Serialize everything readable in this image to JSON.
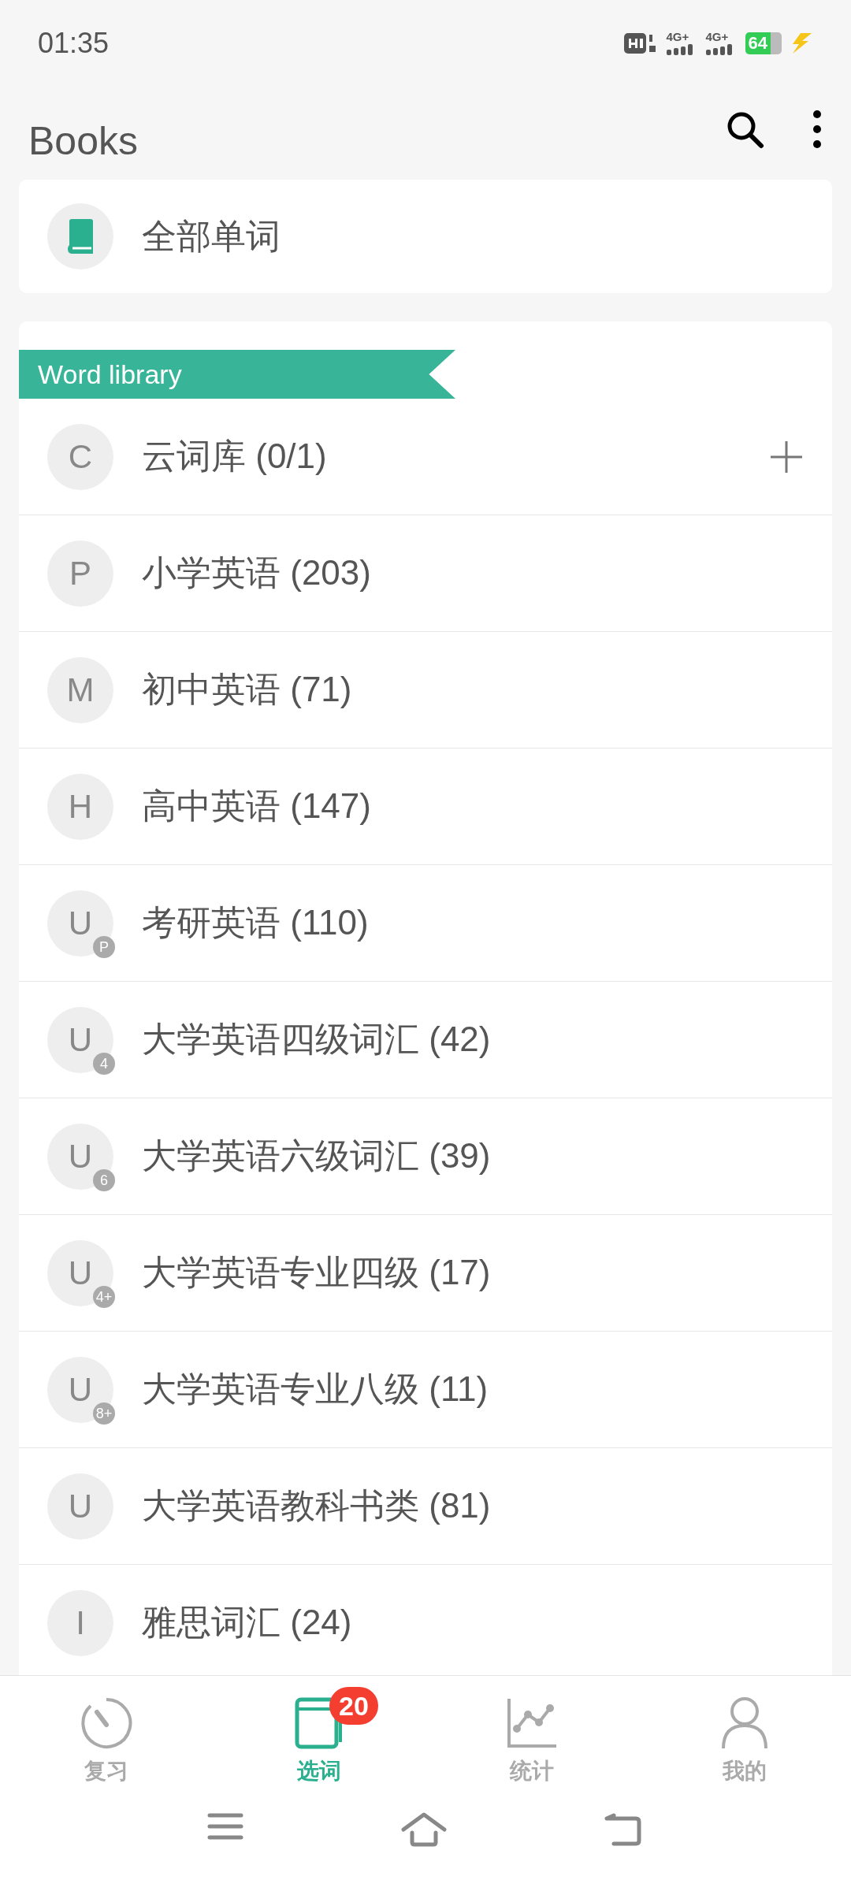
{
  "status_bar": {
    "time": "01:35",
    "network_labels": [
      "4G+",
      "4G+"
    ],
    "battery": "64",
    "charging": true
  },
  "header": {
    "title": "Books"
  },
  "all_words": {
    "label": "全部单词"
  },
  "library": {
    "ribbon": "Word library",
    "items": [
      {
        "letter": "C",
        "label": "云词库 (0/1)",
        "addable": true
      },
      {
        "letter": "P",
        "label": "小学英语 (203)",
        "addable": false
      },
      {
        "letter": "M",
        "label": "初中英语 (71)",
        "addable": false
      },
      {
        "letter": "H",
        "label": "高中英语 (147)",
        "addable": false
      },
      {
        "letter": "U",
        "sub": "P",
        "label": "考研英语 (110)",
        "addable": false
      },
      {
        "letter": "U",
        "sub": "4",
        "label": "大学英语四级词汇 (42)",
        "addable": false
      },
      {
        "letter": "U",
        "sub": "6",
        "label": "大学英语六级词汇 (39)",
        "addable": false
      },
      {
        "letter": "U",
        "sub": "4+",
        "label": "大学英语专业四级 (17)",
        "addable": false
      },
      {
        "letter": "U",
        "sub": "8+",
        "label": "大学英语专业八级 (11)",
        "addable": false
      },
      {
        "letter": "U",
        "label": "大学英语教科书类 (81)",
        "addable": false
      },
      {
        "letter": "I",
        "label": "雅思词汇 (24)",
        "addable": false
      }
    ]
  },
  "bottom_nav": [
    {
      "kind": "timer",
      "label": "复习",
      "selected": false
    },
    {
      "kind": "book",
      "label": "选词",
      "selected": true,
      "badge": "20"
    },
    {
      "kind": "chart",
      "label": "统计",
      "selected": false
    },
    {
      "kind": "person",
      "label": "我的",
      "selected": false
    }
  ]
}
